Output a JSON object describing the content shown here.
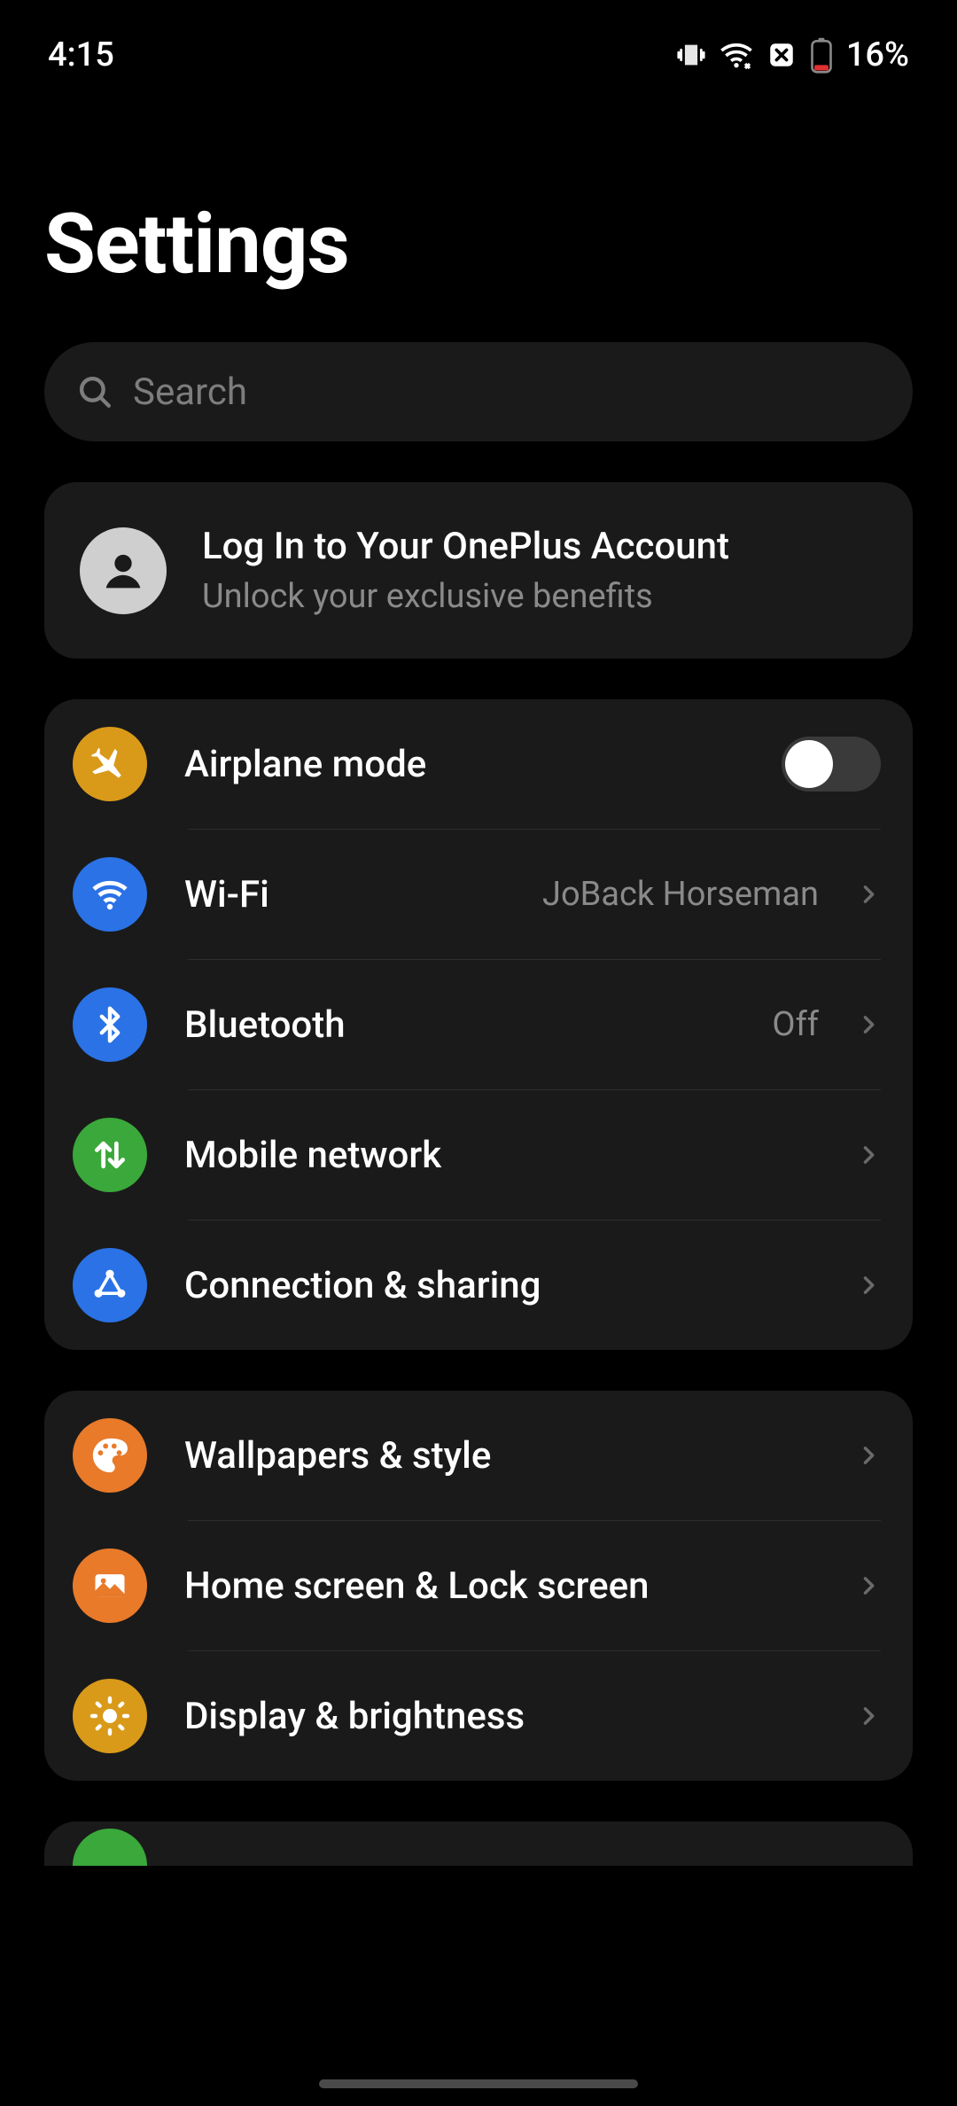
{
  "status_bar": {
    "time": "4:15",
    "battery_percent": "16%"
  },
  "page": {
    "title": "Settings"
  },
  "search": {
    "placeholder": "Search"
  },
  "account": {
    "title": "Log In to Your OnePlus Account",
    "subtitle": "Unlock your exclusive benefits"
  },
  "groups": [
    {
      "rows": [
        {
          "id": "airplane",
          "label": "Airplane mode",
          "icon_bg": "#d99a1a",
          "control": "toggle",
          "toggle_on": false
        },
        {
          "id": "wifi",
          "label": "Wi-Fi",
          "icon_bg": "#2a72e6",
          "control": "link",
          "value": "JoBack Horseman"
        },
        {
          "id": "bluetooth",
          "label": "Bluetooth",
          "icon_bg": "#2a72e6",
          "control": "link",
          "value": "Off"
        },
        {
          "id": "mobile",
          "label": "Mobile network",
          "icon_bg": "#3aa83a",
          "control": "link",
          "value": ""
        },
        {
          "id": "connection",
          "label": "Connection & sharing",
          "icon_bg": "#2a72e6",
          "control": "link",
          "value": ""
        }
      ]
    },
    {
      "rows": [
        {
          "id": "wallpapers",
          "label": "Wallpapers & style",
          "icon_bg": "#e87a2a",
          "control": "link",
          "value": ""
        },
        {
          "id": "homescreen",
          "label": "Home screen & Lock screen",
          "icon_bg": "#e87a2a",
          "control": "link",
          "value": ""
        },
        {
          "id": "display",
          "label": "Display & brightness",
          "icon_bg": "#d99a1a",
          "control": "link",
          "value": ""
        }
      ]
    }
  ]
}
